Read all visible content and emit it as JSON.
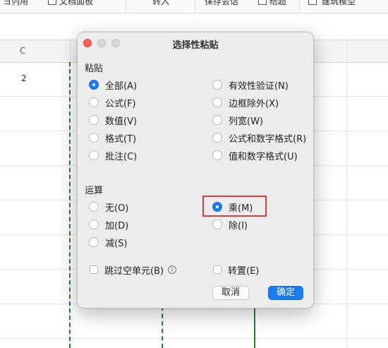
{
  "toolbar": {
    "frag1": "ヨ列用",
    "frag2": "文档面板",
    "frag3": "转入",
    "frag4": "保存会话",
    "frag5": "给超",
    "frag6": "建筑模型"
  },
  "sheet": {
    "column_letter": "C",
    "cell_value": "2"
  },
  "dialog": {
    "title": "选择性粘贴",
    "paste_section": "粘贴",
    "paste_left": [
      "全部(A)",
      "公式(F)",
      "数值(V)",
      "格式(T)",
      "批注(C)"
    ],
    "paste_right": [
      "有效性验证(N)",
      "边框除外(X)",
      "列宽(W)",
      "公式和数字格式(R)",
      "值和数字格式(U)"
    ],
    "paste_selected": "全部(A)",
    "operation_section": "运算",
    "op_left": [
      "无(O)",
      "加(D)",
      "减(S)"
    ],
    "op_right": [
      "乘(M)",
      "除(I)"
    ],
    "op_selected": "乘(M)",
    "skip_blanks": "跳过空单元(B)",
    "transpose": "转置(E)",
    "info_glyph": "i",
    "cancel": "取消",
    "ok": "确定"
  },
  "colors": {
    "accent": "#1a7cf0",
    "highlight": "#e23b3b",
    "copy_border": "#2e7d32"
  }
}
